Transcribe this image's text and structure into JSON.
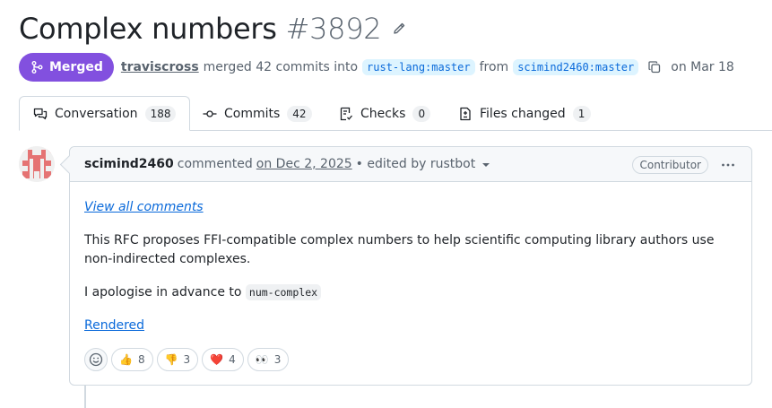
{
  "pr": {
    "title": "Complex numbers",
    "number": "#3892",
    "status": "Merged",
    "merger": "traviscross",
    "merged_text": "merged 42 commits into",
    "base_branch": "rust-lang:master",
    "from_text": "from",
    "head_branch": "scimind2460:master",
    "date_text": "on Mar 18"
  },
  "tabs": [
    {
      "label": "Conversation",
      "count": "188",
      "icon": "comment-discussion-icon"
    },
    {
      "label": "Commits",
      "count": "42",
      "icon": "git-commit-icon"
    },
    {
      "label": "Checks",
      "count": "0",
      "icon": "checklist-icon"
    },
    {
      "label": "Files changed",
      "count": "1",
      "icon": "file-diff-icon"
    }
  ],
  "comment": {
    "author": "scimind2460",
    "action": "commented",
    "date": "on Dec 2, 2025",
    "edited": "• edited by rustbot",
    "role": "Contributor",
    "view_all": "View all comments",
    "body_text": "This RFC proposes FFI-compatible complex numbers to help scientific computing library authors use non-indirected complexes.",
    "apology_prefix": "I apologise in advance to",
    "apology_code": "num-complex",
    "rendered_link": "Rendered"
  },
  "reactions": [
    {
      "emoji": "👍",
      "count": "8",
      "name": "thumbs-up"
    },
    {
      "emoji": "👎",
      "count": "3",
      "name": "thumbs-down"
    },
    {
      "emoji": "❤️",
      "count": "4",
      "name": "heart"
    },
    {
      "emoji": "👀",
      "count": "3",
      "name": "eyes"
    }
  ],
  "colors": {
    "merged": "#8250df",
    "link": "#0969da",
    "border": "#d1d9e0"
  }
}
